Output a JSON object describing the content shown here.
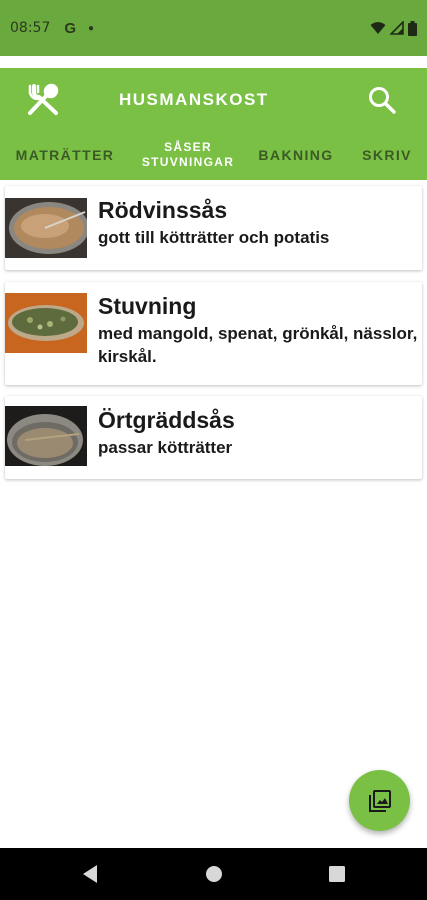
{
  "status_bar": {
    "time": "08:57",
    "icons": [
      "google-icon",
      "notification-dot-icon",
      "wifi-icon",
      "signal-icon",
      "battery-icon"
    ]
  },
  "app_bar": {
    "title": "HUSMANSKOST",
    "colors": {
      "status": "#6aa93d",
      "bar": "#7ac045",
      "tab_inactive": "#3c5a26"
    }
  },
  "tabs": [
    {
      "label": "MATRÄTTER"
    },
    {
      "label": "SÅSER STUVNINGAR",
      "active": true,
      "line1": "SÅSER",
      "line2": "STUVNINGAR"
    },
    {
      "label": "BAKNING"
    },
    {
      "label": "SKRIV"
    }
  ],
  "recipes": [
    {
      "name": "Rödvinssås",
      "description": "gott till kötträtter och potatis"
    },
    {
      "name": "Stuvning",
      "description": "med mangold, spenat, grönkål, nässlor, kirskål."
    },
    {
      "name": "Örtgräddsås",
      "description": "passar kötträtter"
    }
  ],
  "fab": {
    "icon": "gallery-icon"
  },
  "nav": {
    "icons": [
      "back-icon",
      "home-icon",
      "recents-icon"
    ]
  }
}
